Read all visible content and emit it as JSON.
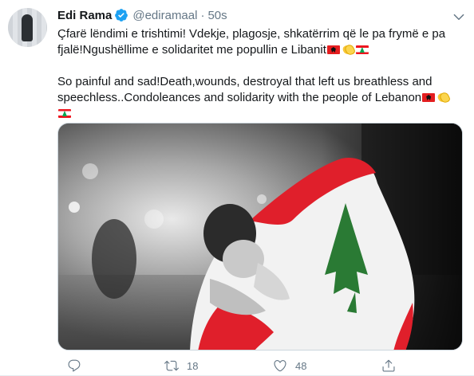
{
  "tweet": {
    "author": {
      "name": "Edi Rama",
      "handle": "@ediramaal",
      "verified": true
    },
    "separator": "·",
    "time": "50s",
    "text_lines": [
      "Çfarë lëndimi e trishtimi! Vdekje, plagosje, shkatërrim që le pa frymë e pa",
      "fjalë!Ngushëllime e solidaritet me popullin e Libanit",
      "",
      "So painful and sad!Death,wounds, destroyal that left us breathless and",
      "speechless..Condoleances and solidarity with the people of Lebanon"
    ],
    "emoji": [
      "flag-albania",
      "clapping-hands",
      "flag-lebanon"
    ],
    "actions": {
      "reply_count": "",
      "retweet_count": "18",
      "like_count": "48"
    },
    "icons": [
      "verified-badge-icon",
      "caret-down-icon",
      "reply-icon",
      "retweet-icon",
      "like-icon",
      "share-icon"
    ],
    "colors": {
      "verified": "#1da1f2",
      "muted_text": "#657786",
      "primary_text": "#14171a",
      "lebanon_red": "#ee161f",
      "lebanon_green": "#00a651",
      "albania_red": "#e41e20"
    }
  }
}
